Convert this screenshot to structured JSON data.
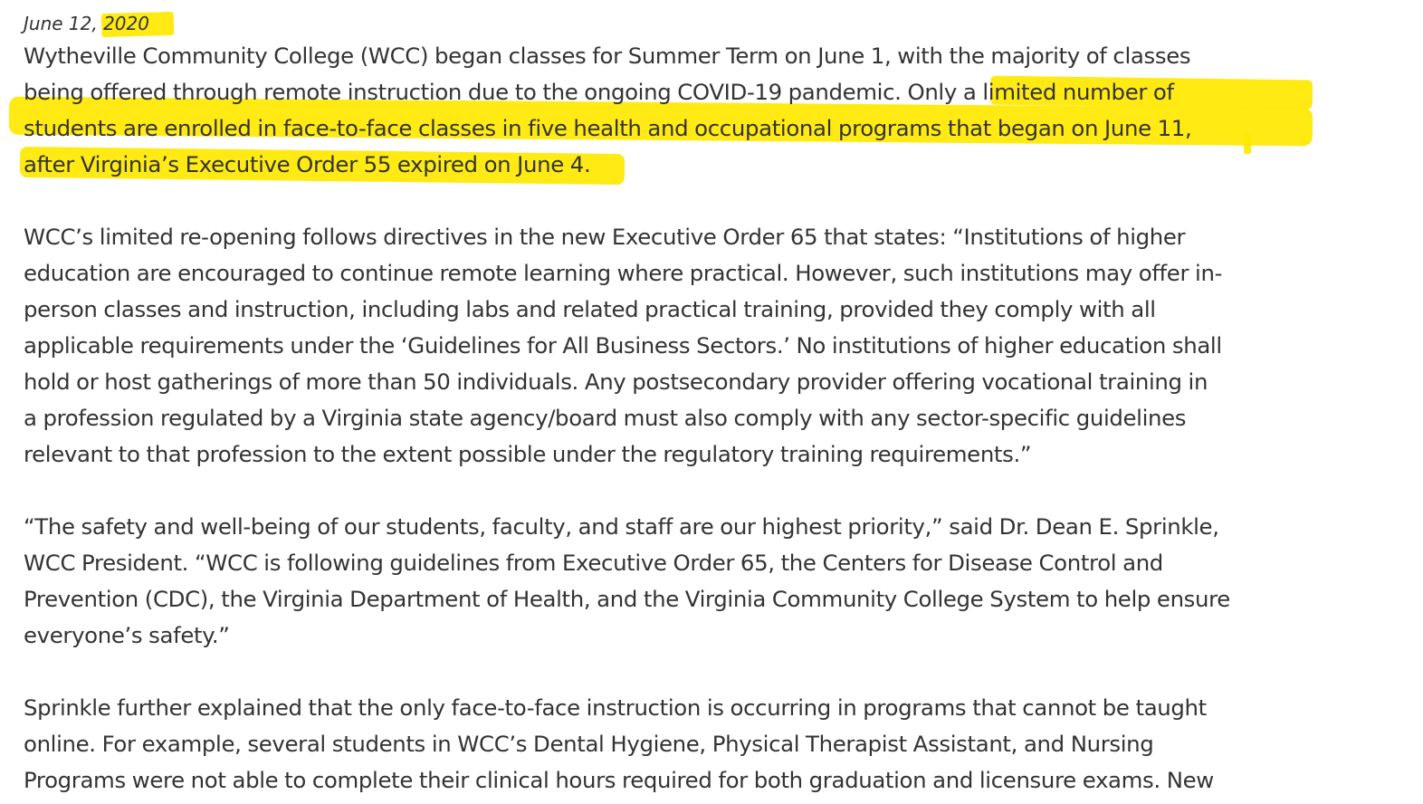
{
  "article": {
    "date": "June 12, 2020",
    "highlight_color": "#FFE800",
    "paragraphs": [
      {
        "lines": [
          "Wytheville Community College (WCC) began classes for Summer Term on June 1, with the majority of classes",
          "being offered through remote instruction due to the ongoing COVID-19 pandemic. Only a limited number of",
          "students are enrolled in face-to-face classes in five health and occupational programs that began on June 11,",
          "after Virginia’s Executive Order 55 expired on June 4."
        ]
      },
      {
        "lines": [
          "WCC’s limited re-opening follows directives in the new Executive Order 65 that states: “Institutions of higher",
          "education are encouraged to continue remote learning where practical. However, such institutions may offer in-",
          "person classes and instruction, including labs and related practical training, provided they comply with all",
          "applicable requirements under the ‘Guidelines for All Business Sectors.’ No institutions of higher education shall",
          "hold or host gatherings of more than 50 individuals. Any postsecondary provider offering vocational training in",
          "a profession regulated by a Virginia state agency/board must also comply with any sector-specific guidelines",
          "relevant to that profession to the extent possible under the regulatory training requirements.”"
        ]
      },
      {
        "lines": [
          "“The safety and well-being of our students, faculty, and staff are our highest priority,” said Dr. Dean E. Sprinkle,",
          "WCC President. “WCC is following guidelines from Executive Order 65, the Centers for Disease Control and",
          "Prevention (CDC), the Virginia Department of Health, and the Virginia Community College System to help ensure",
          "everyone’s safety.”"
        ]
      },
      {
        "lines": [
          "Sprinkle further explained that the only face-to-face instruction is occurring in programs that cannot be taught",
          "online. For example, several students in WCC’s Dental Hygiene, Physical Therapist Assistant, and Nursing",
          "Programs were not able to complete their clinical hours required for both graduation and licensure exams. New"
        ]
      }
    ]
  }
}
